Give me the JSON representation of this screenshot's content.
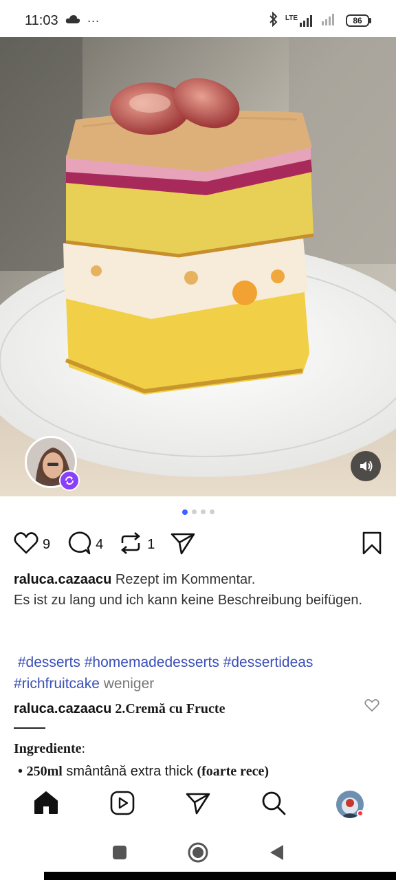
{
  "status_bar": {
    "time": "11:03",
    "extra": "···",
    "network": "LTE",
    "battery": "86"
  },
  "post": {
    "media": {
      "current_slide": 1,
      "total_slides": 4
    },
    "likes": "9",
    "comments": "4",
    "reposts": "1",
    "caption": {
      "username": "raluca.cazaacu",
      "line1": " Rezept im Kommentar.",
      "line2": "Es ist zu lang und ich kann keine Beschreibung beifügen."
    },
    "hashtags": [
      "#desserts",
      "#homemadedesserts",
      "#dessertideas",
      "#richfruitcake"
    ],
    "less_label": "weniger"
  },
  "comment": {
    "username": "raluca.cazaacu",
    "title": " 2.Cremă cu Fructe",
    "ingredients_heading": "Ingrediente",
    "ingredients_colon": ":",
    "item_bullet": "• ",
    "item_qty": "250ml",
    "item_text": " smântână extra thick ",
    "item_note": "(foarte rece)"
  },
  "nav": {
    "items": [
      "home-icon",
      "reels-icon",
      "send-icon",
      "search-icon",
      "profile-avatar"
    ]
  },
  "colors": {
    "accent": "#3c64ff",
    "hashtag": "#3a4fb8",
    "remix_badge": "#8a3ffc",
    "notification": "#ff3040"
  }
}
